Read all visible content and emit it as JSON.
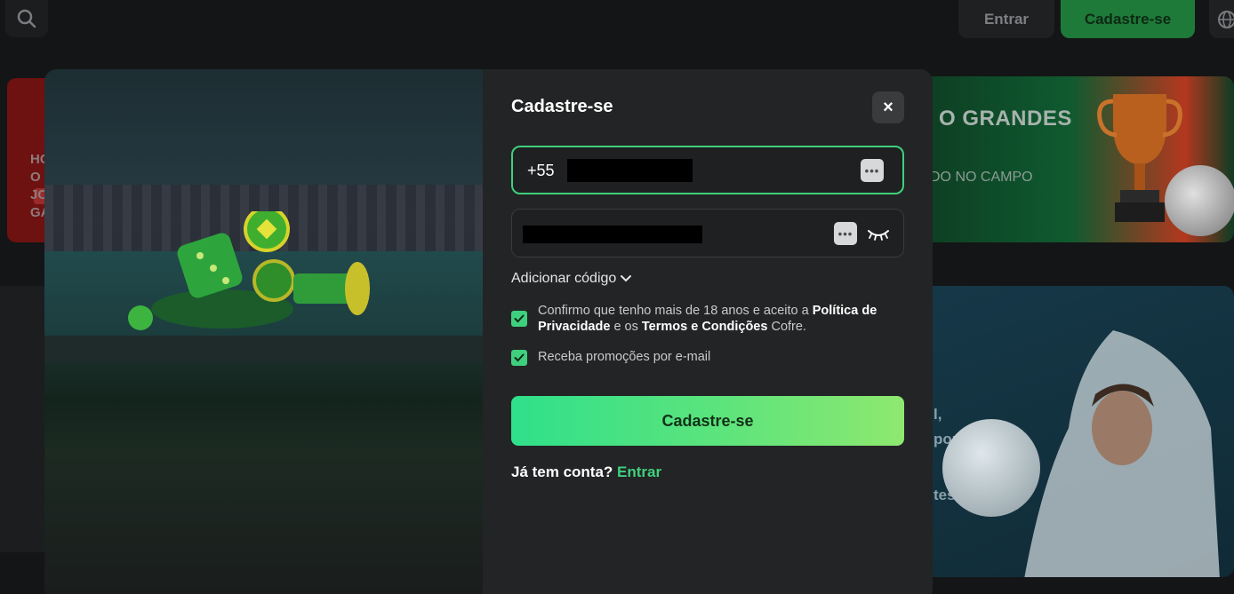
{
  "header": {
    "login_label": "Entrar",
    "signup_label": "Cadastre-se",
    "accent": "#1e7a39"
  },
  "background": {
    "banner_left_lines": [
      "HC",
      "O",
      "JC",
      "GA"
    ],
    "banner_right_heading": "O GRANDES",
    "banner_right_sub": "DO NO CAMPO",
    "card_right_lines": [
      "l,",
      "porti",
      "tes"
    ]
  },
  "modal": {
    "title": "Cadastre-se",
    "close_symbol": "×",
    "phone_prefix": "+55",
    "add_code_label": "Adicionar código",
    "terms": {
      "part1": "Confirmo que tenho mais de 18 anos e aceito a ",
      "privacy": "Política de Privacidade",
      "part2": " e os ",
      "terms": "Termos e Condições",
      "part3": " Cofre."
    },
    "promo_label": "Receba promoções por e-mail",
    "terms_checked": true,
    "promo_checked": true,
    "submit_label": "Cadastre-se",
    "have_account": "Já tem conta?",
    "login_link": "Entrar",
    "accent": "#3fd07e"
  }
}
